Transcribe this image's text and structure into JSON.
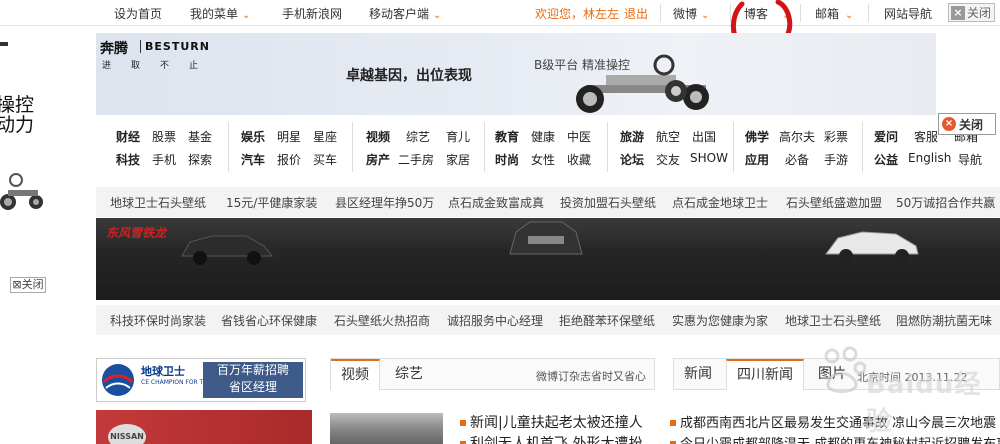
{
  "topbar": {
    "set_home": "设为首页",
    "my_menu": "我的菜单",
    "mobile_sina": "手机新浪网",
    "mobile_client": "移动客户端",
    "welcome": "欢迎您，林左左",
    "logout": "退出",
    "weibo": "微博",
    "blog": "博客",
    "mail": "邮箱",
    "site_nav": "网站导航",
    "close": "关闭"
  },
  "left_ad": {
    "line1": "操控",
    "line2": "动力",
    "close": "关闭"
  },
  "banner": {
    "brand_cn": "奔腾",
    "brand_en": "BESTURN",
    "slogan": "进取不止",
    "headline": "卓越基因，出位表现",
    "platform": "B级平台 精准操控"
  },
  "right_close": "关闭",
  "portal_nav": [
    {
      "cells": [
        [
          "财经",
          "股票",
          "基金"
        ],
        [
          "科技",
          "手机",
          "探索"
        ]
      ]
    },
    {
      "cells": [
        [
          "娱乐",
          "明星",
          "星座"
        ],
        [
          "汽车",
          "报价",
          "买车"
        ]
      ]
    },
    {
      "cells": [
        [
          "视频",
          "综艺",
          "育儿"
        ],
        [
          "房产",
          "二手房",
          "家居"
        ]
      ]
    },
    {
      "cells": [
        [
          "教育",
          "健康",
          "中医"
        ],
        [
          "时尚",
          "女性",
          "收藏"
        ]
      ]
    },
    {
      "cells": [
        [
          "旅游",
          "航空",
          "出国"
        ],
        [
          "论坛",
          "交友",
          "SHOW"
        ]
      ]
    },
    {
      "cells": [
        [
          "佛学",
          "高尔夫",
          "彩票"
        ],
        [
          "应用",
          "必备",
          "手游"
        ]
      ]
    },
    {
      "cells": [
        [
          "爱问",
          "客服",
          "邮箱"
        ],
        [
          "公益",
          "English",
          "导航"
        ]
      ]
    }
  ],
  "strip1": [
    "地球卫士石头壁纸",
    "15元/平健康家装",
    "县区经理年挣50万",
    "点石成金致富成真",
    "投资加盟石头壁纸",
    "点石成金地球卫士",
    "石头壁纸盛邀加盟",
    "50万诚招合作共赢"
  ],
  "cars_label": "东风雪铁龙",
  "strip2": [
    "科技环保时尚家装",
    "省钱省心环保健康",
    "石头壁纸火热招商",
    "诚招服务中心经理",
    "拒绝醛苯环保壁纸",
    "实惠为您健康为家",
    "地球卫士石头壁纸",
    "阻燃防潮抗菌无味"
  ],
  "job_ad": {
    "logo": "地球卫士",
    "sub": "CE CHAMPION FOR THE EARTH",
    "line1": "百万年薪招聘",
    "line2": "省区经理"
  },
  "mid_tabs": {
    "tabs": [
      "视频",
      "综艺"
    ],
    "note": "微博订杂志省时又省心"
  },
  "news_tabs": {
    "tabs": [
      "新闻",
      "四川新闻",
      "图片"
    ],
    "date": "北京时间 2013.11.22"
  },
  "nissan": "NISSAN",
  "mid_news": [
    "新闻|儿童扶起老太被还撞人",
    "利剑无人机首飞 外形大遭扮"
  ],
  "right_news": [
    "成都西南西北片区最易发生交通事故 凉山今晨三次地震",
    "今日少霾成都部降温天 成都的更东神秘村起近招聘发布事"
  ],
  "watermark": "Baidu经验"
}
